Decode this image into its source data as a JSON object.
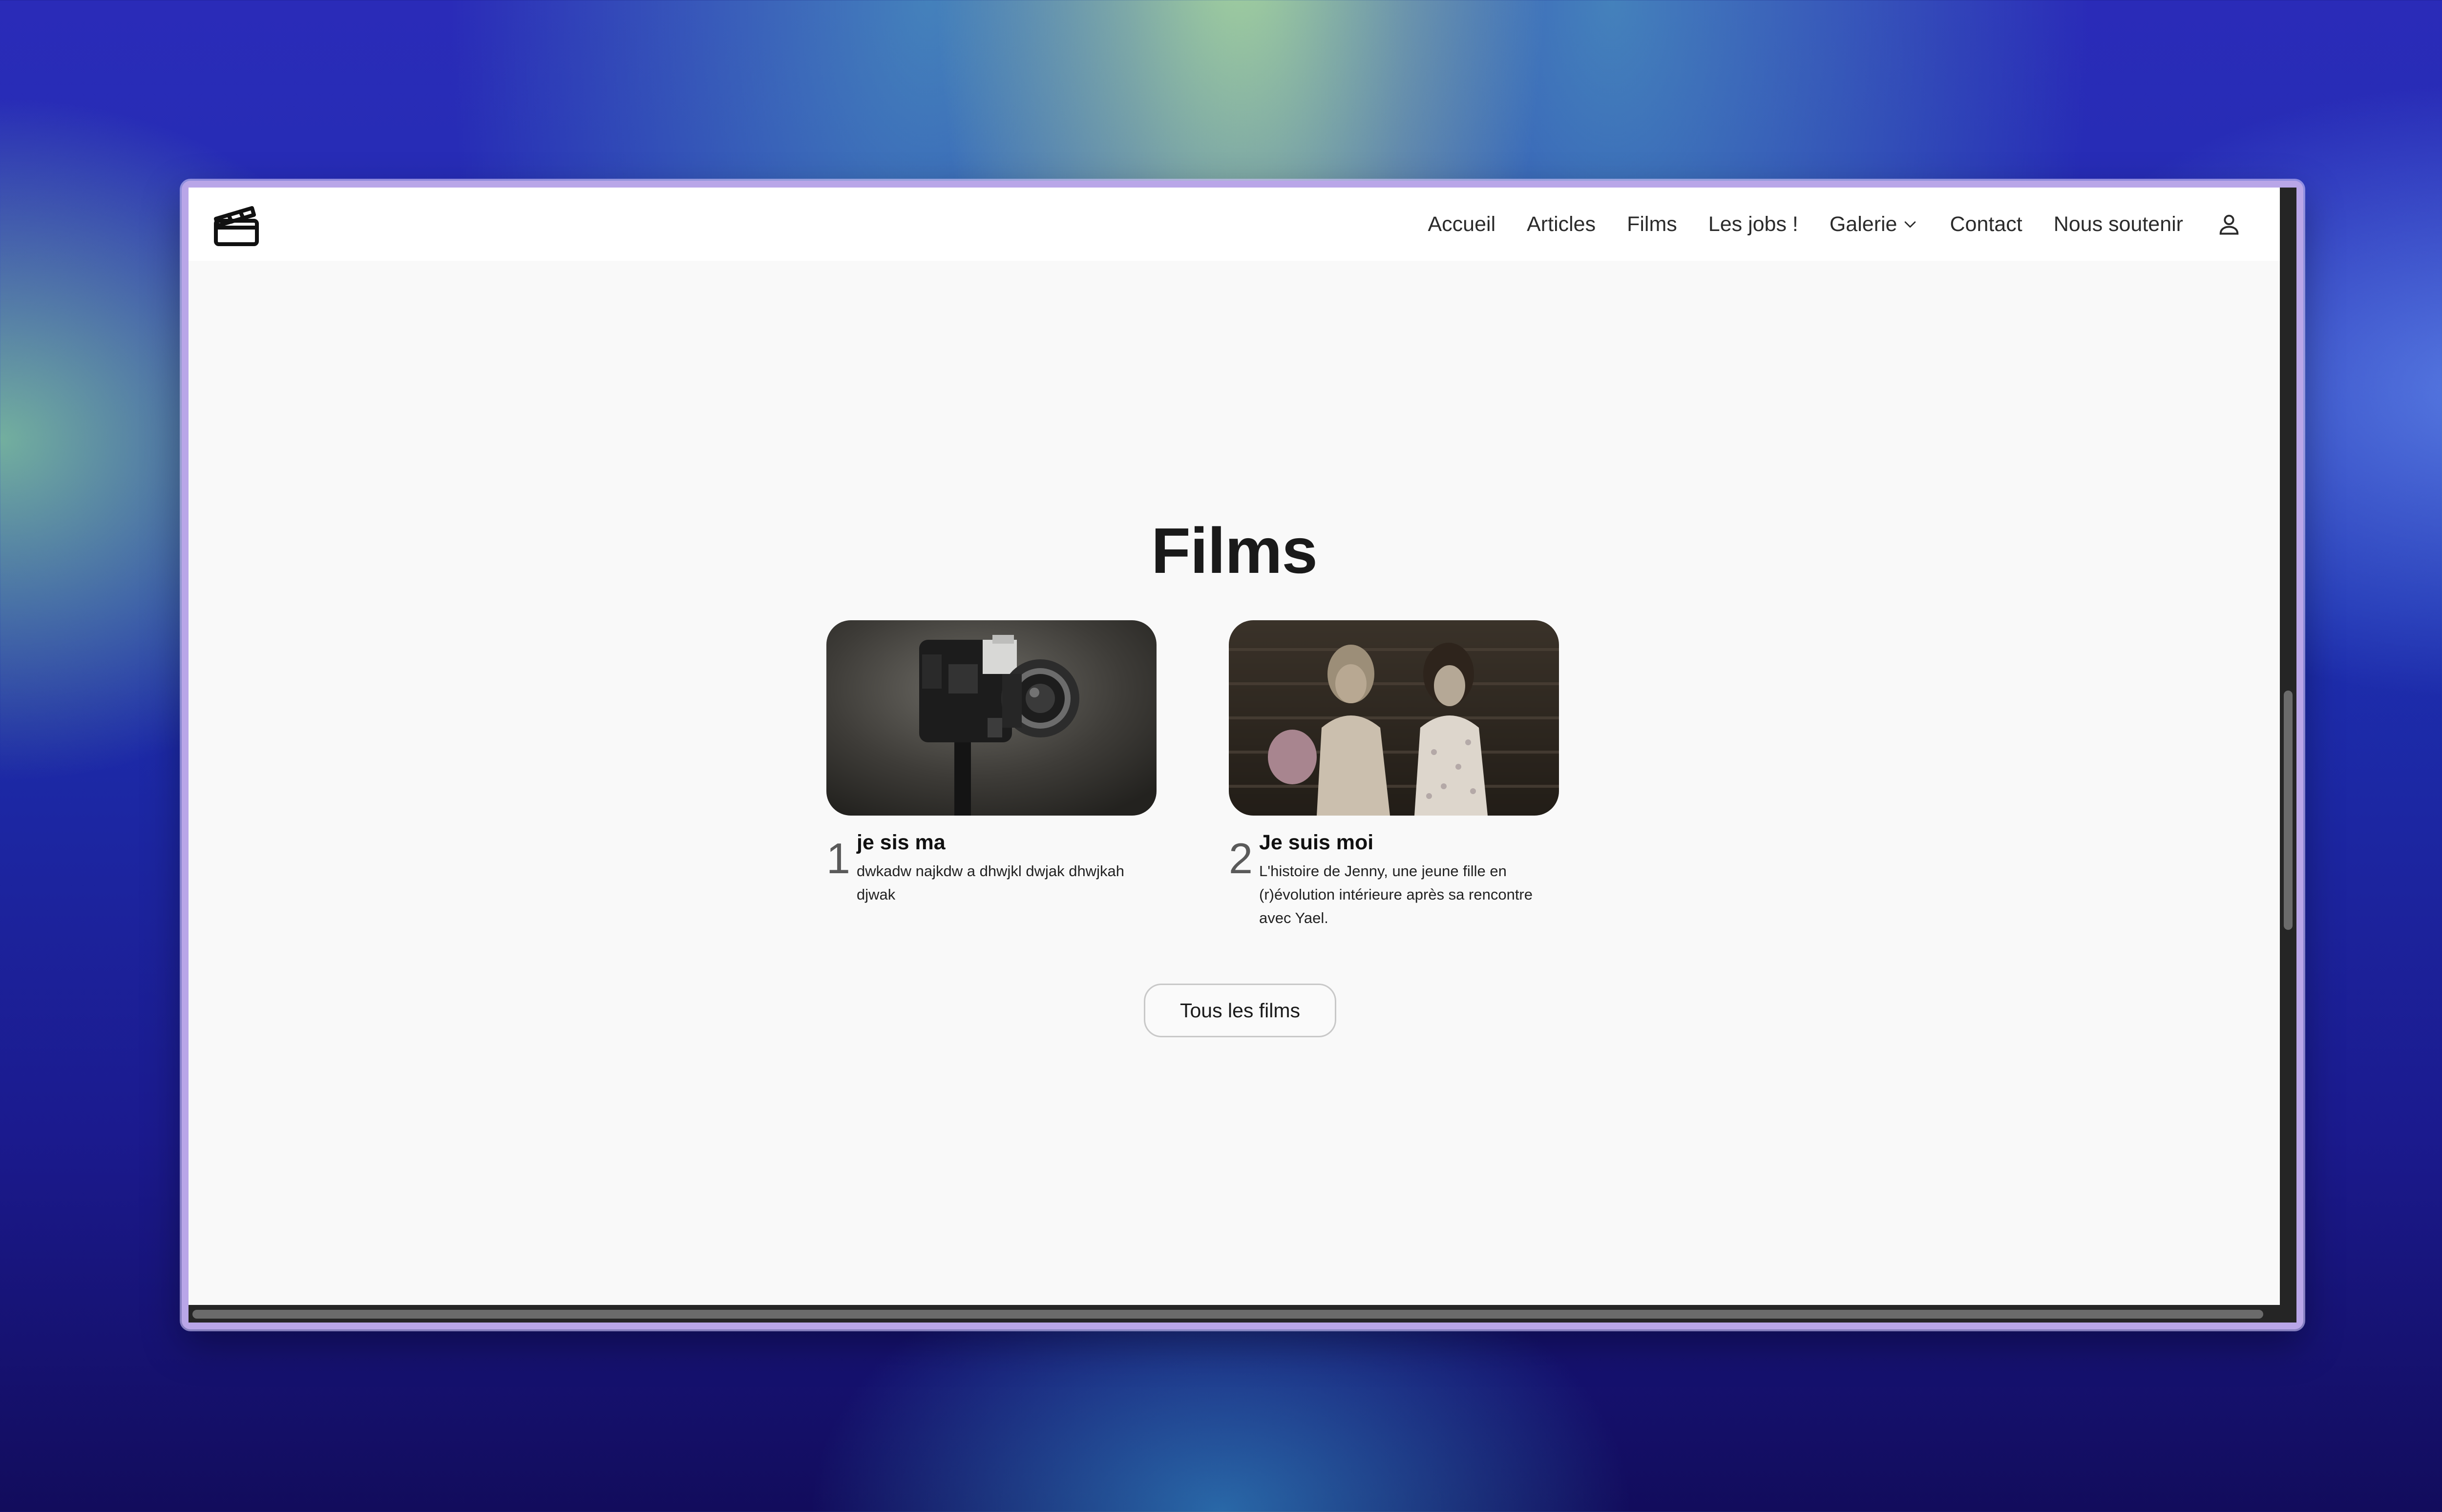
{
  "nav": {
    "items": [
      {
        "label": "Accueil"
      },
      {
        "label": "Articles"
      },
      {
        "label": "Films"
      },
      {
        "label": "Les jobs !"
      },
      {
        "label": "Galerie",
        "has_dropdown": true
      },
      {
        "label": "Contact"
      },
      {
        "label": "Nous soutenir"
      }
    ],
    "logo_icon": "clapperboard-icon",
    "user_icon": "user-icon",
    "dropdown_icon": "chevron-down-icon"
  },
  "page": {
    "title": "Films"
  },
  "films": [
    {
      "number": "1",
      "title": "je sis ma",
      "description": "dwkadw najkdw a dhwjkl dwjak dhwjkah djwak",
      "image": "vintage film camera"
    },
    {
      "number": "2",
      "title": "Je suis moi",
      "description": "L'histoire de Jenny, une jeune fille en (r)évolution intérieure après sa rencontre avec Yael.",
      "image": "two girls sitting on stairs"
    }
  ],
  "buttons": {
    "all_films": "Tous les films"
  },
  "colors": {
    "page_background": "#f9f9f9",
    "navbar_background": "#ffffff",
    "title_text": "#1a1a1a",
    "window_border": "#b9a6e8",
    "scrollbar": "#252525"
  }
}
